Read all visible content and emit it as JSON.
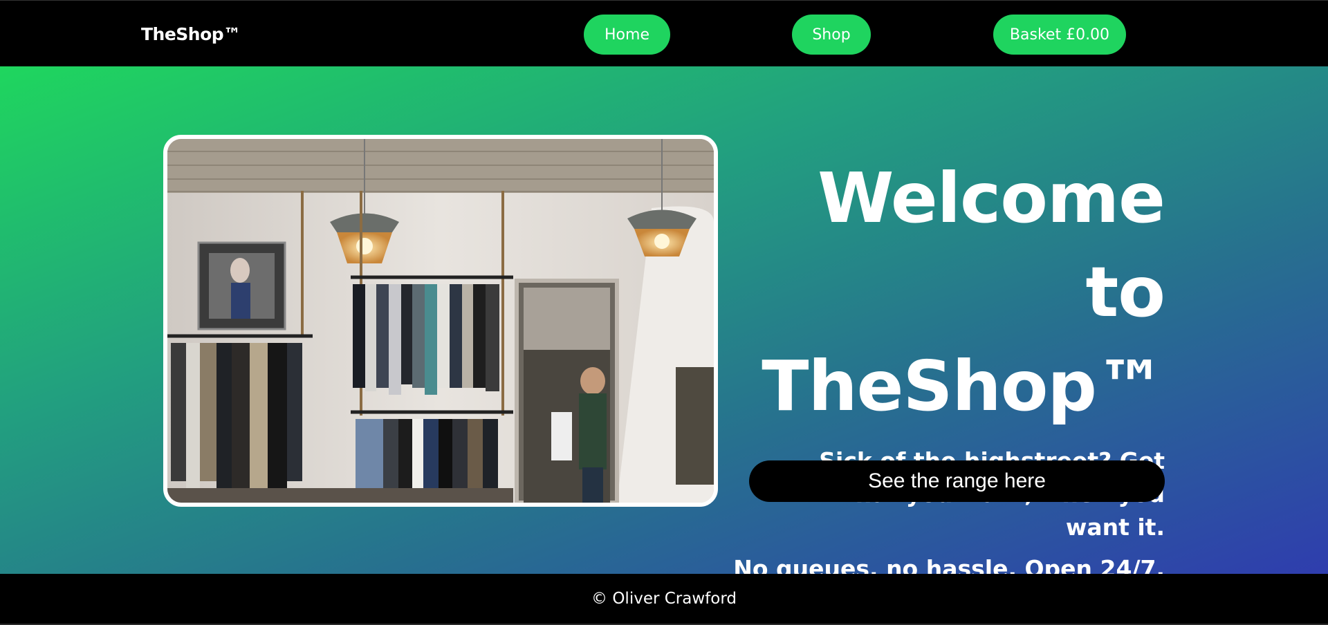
{
  "navbar": {
    "brand": "TheShop™",
    "home_label": "Home",
    "shop_label": "Shop",
    "basket_label": "Basket £0.00"
  },
  "hero": {
    "headline": "Welcome to TheShop™",
    "tagline_1": "Sick of the highstreet? Get what you want, when you want it.",
    "tagline_2": "No queues, no hassle. Open 24/7.",
    "cta_label": "See the range here",
    "image_icon": "clothing-store-photo"
  },
  "footer": {
    "copyright": "© Oliver Crawford"
  },
  "colors": {
    "accent": "#1fd45f",
    "gradient_start": "#1fd65e",
    "gradient_end": "#2f3dae",
    "bar_background": "#000000"
  }
}
